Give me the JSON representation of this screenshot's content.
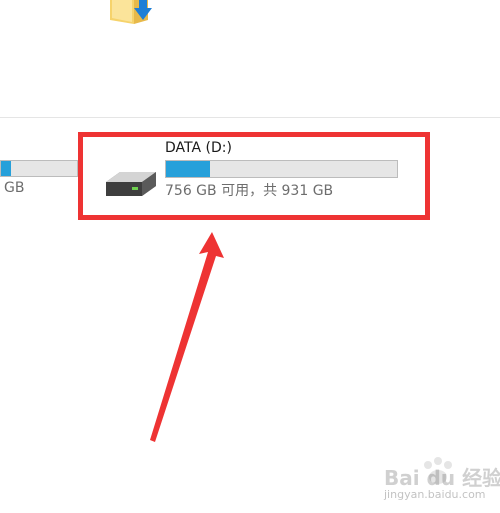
{
  "partial_drive": {
    "size_suffix": "GB",
    "usage_fraction": 0.13
  },
  "drive": {
    "name": "DATA (D:)",
    "space_text": "756 GB 可用，共 931 GB",
    "usage_fraction": 0.19,
    "icon": "hard-drive-icon",
    "bar_color": "#26a0da"
  },
  "annotation": {
    "highlight_color": "#ee3333"
  },
  "watermark": {
    "logo": "Bai du 经验",
    "url": "jingyan.baidu.com"
  }
}
